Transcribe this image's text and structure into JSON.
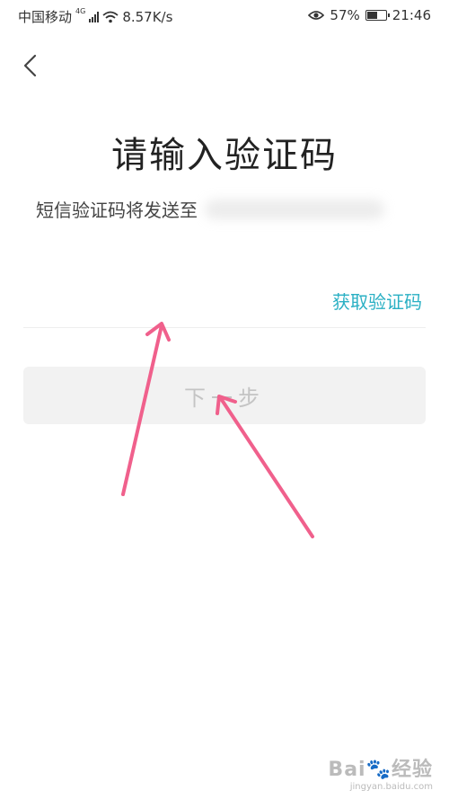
{
  "status_bar": {
    "carrier": "中国移动",
    "network": "4G",
    "speed": "8.57K/s",
    "battery": "57%",
    "battery_level": 0.57,
    "time": "21:46"
  },
  "nav": {
    "back_icon": "chevron-left-icon"
  },
  "page": {
    "title": "请输入验证码",
    "sms_hint": "短信验证码将发送至"
  },
  "form": {
    "code_input_value": "",
    "get_code_label": "获取验证码",
    "next_label": "下一步"
  },
  "colors": {
    "accent": "#2ab0c4",
    "annotation_arrow": "#f0608c",
    "disabled_button_bg": "#f2f2f2",
    "disabled_button_text": "#c4c4c4"
  },
  "watermark": {
    "brand": "Bai",
    "brand_suffix": "经验",
    "url": "jingyan.baidu.com"
  }
}
